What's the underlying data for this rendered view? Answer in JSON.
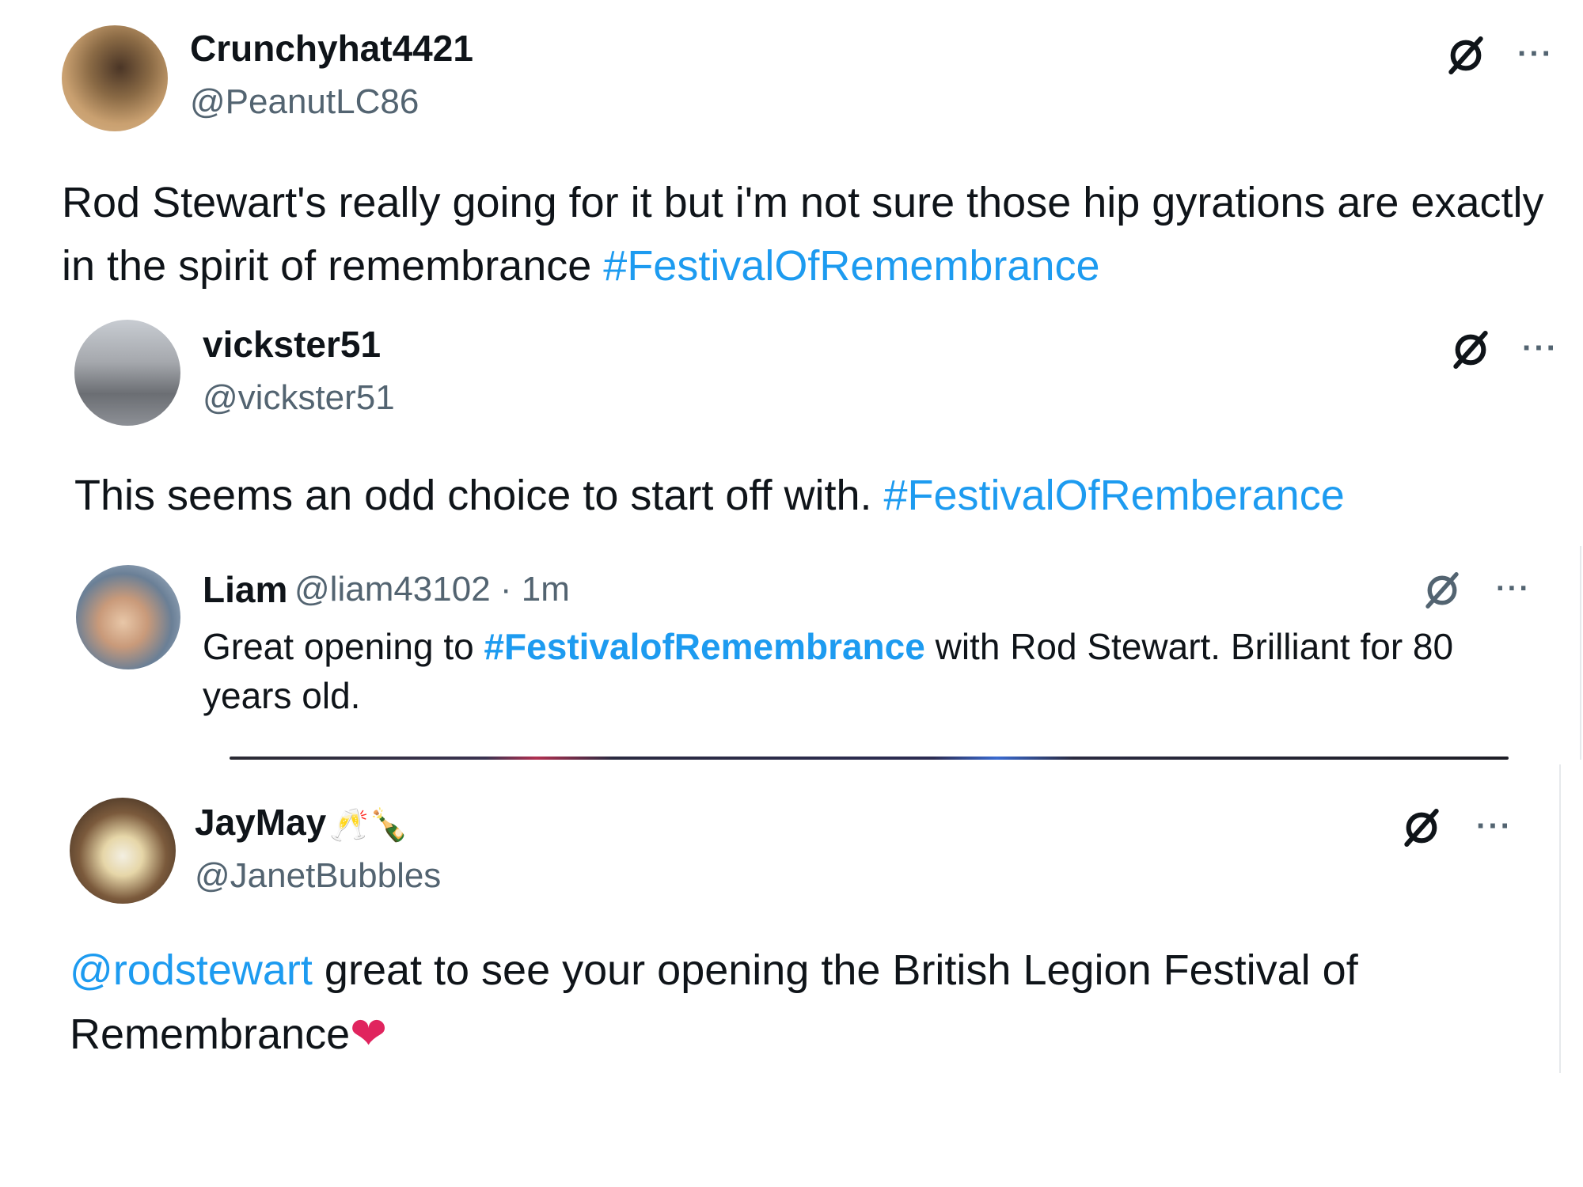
{
  "posts": [
    {
      "display_name": "Crunchyhat4421",
      "handle": "@PeanutLC86",
      "text": "Rod Stewart's really going for it but i'm not sure those hip gyrations are exactly in the spirit of remembrance ",
      "hashtag": "#FestivalOfRemembrance",
      "more": "···",
      "grok_icon": "grok-icon",
      "more_icon": "more-icon"
    },
    {
      "display_name": "vickster51",
      "handle": "@vickster51",
      "text": "This seems an odd choice to start off with.  ",
      "hashtag": "#FestivalOfRemberance",
      "more": "···"
    },
    {
      "display_name": "Liam",
      "handle_time": "@liam43102 · 1m",
      "text_before": "Great opening to ",
      "hashtag": "#FestivalofRemembrance",
      "text_after": " with Rod Stewart. Brilliant for 80 years old.",
      "more": "···"
    },
    {
      "display_name": "JayMay",
      "name_emoji": "🥂🍾",
      "handle": "@JanetBubbles",
      "mention": "@rodstewart",
      "text": " great to see your opening the British Legion Festival of Remembrance",
      "trailing_emoji": "❤",
      "more": "···"
    }
  ],
  "colors": {
    "link": "#1d9bf0",
    "text": "#0f1419",
    "secondary": "#536471",
    "heart": "#e0245e"
  }
}
